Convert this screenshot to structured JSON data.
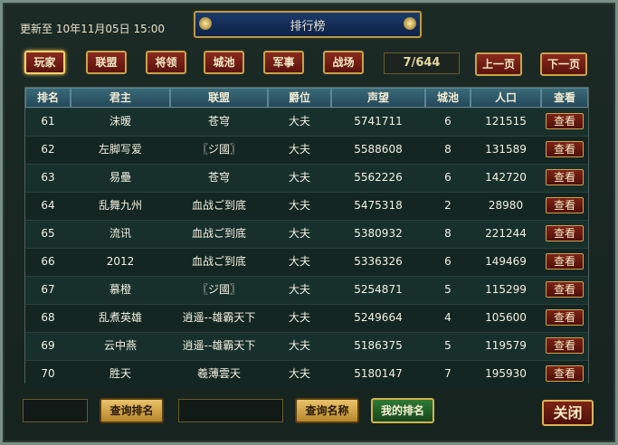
{
  "header": {
    "update_text": "更新至 10年11月05日 15:00",
    "title": "排行榜"
  },
  "tabs": [
    {
      "label": "玩家"
    },
    {
      "label": "联盟"
    },
    {
      "label": "将领"
    },
    {
      "label": "城池"
    },
    {
      "label": "军事"
    },
    {
      "label": "战场"
    }
  ],
  "pager": {
    "page_display": "7/644",
    "prev_label": "上一页",
    "next_label": "下一页"
  },
  "table": {
    "columns": [
      "排名",
      "君主",
      "联盟",
      "爵位",
      "声望",
      "城池",
      "人口",
      "查看"
    ],
    "rows": [
      {
        "rank": "61",
        "lord": "沫暧",
        "alliance": "苍穹",
        "title": "大夫",
        "prestige": "5741711",
        "cities": "6",
        "population": "121515",
        "view": "查看"
      },
      {
        "rank": "62",
        "lord": "左脚写爱",
        "alliance": "〖ジ國〗",
        "title": "大夫",
        "prestige": "5588608",
        "cities": "8",
        "population": "131589",
        "view": "查看"
      },
      {
        "rank": "63",
        "lord": "易壘",
        "alliance": "苍穹",
        "title": "大夫",
        "prestige": "5562226",
        "cities": "6",
        "population": "142720",
        "view": "查看"
      },
      {
        "rank": "64",
        "lord": "乱舞九州",
        "alliance": "血战ご到底",
        "title": "大夫",
        "prestige": "5475318",
        "cities": "2",
        "population": "28980",
        "view": "查看"
      },
      {
        "rank": "65",
        "lord": "流讯",
        "alliance": "血战ご到底",
        "title": "大夫",
        "prestige": "5380932",
        "cities": "8",
        "population": "221244",
        "view": "查看"
      },
      {
        "rank": "66",
        "lord": "2012",
        "alliance": "血战ご到底",
        "title": "大夫",
        "prestige": "5336326",
        "cities": "6",
        "population": "149469",
        "view": "查看"
      },
      {
        "rank": "67",
        "lord": "慕橙",
        "alliance": "〖ジ國〗",
        "title": "大夫",
        "prestige": "5254871",
        "cities": "5",
        "population": "115299",
        "view": "查看"
      },
      {
        "rank": "68",
        "lord": "乱煮英雄",
        "alliance": "逍遥--雄霸天下",
        "title": "大夫",
        "prestige": "5249664",
        "cities": "4",
        "population": "105600",
        "view": "查看"
      },
      {
        "rank": "69",
        "lord": "云中燕",
        "alliance": "逍遥--雄霸天下",
        "title": "大夫",
        "prestige": "5186375",
        "cities": "5",
        "population": "119579",
        "view": "查看"
      },
      {
        "rank": "70",
        "lord": "胜天",
        "alliance": "羲薄雲天",
        "title": "大夫",
        "prestige": "5180147",
        "cities": "7",
        "population": "195930",
        "view": "查看"
      }
    ]
  },
  "footer": {
    "rank_search_label": "查询排名",
    "name_search_label": "查询名称",
    "my_rank_label": "我的排名",
    "close_label": "关闭"
  }
}
